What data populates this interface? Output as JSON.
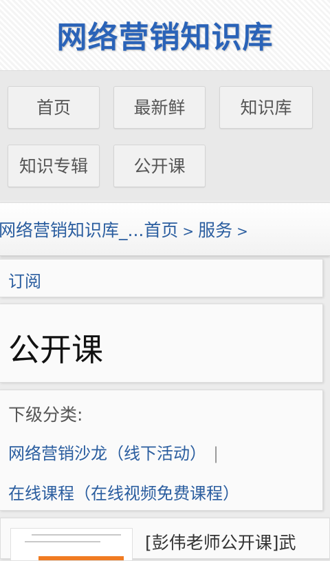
{
  "header": {
    "site_title": "网络营销知识库"
  },
  "nav": {
    "items": [
      {
        "label": "首页"
      },
      {
        "label": "最新鲜"
      },
      {
        "label": "知识库"
      },
      {
        "label": "知识专辑"
      },
      {
        "label": "公开课"
      }
    ]
  },
  "breadcrumb": {
    "items": [
      {
        "label": "网络营销知识库_..."
      },
      {
        "label": "首页"
      },
      {
        "label": "服务"
      }
    ],
    "separator": ">"
  },
  "subscribe": {
    "label": "订阅"
  },
  "page": {
    "heading": "公开课"
  },
  "subcategories": {
    "label": "下级分类:",
    "items": [
      {
        "label": "网络营销沙龙（线下活动）"
      },
      {
        "label": "在线课程（在线视频免费课程）"
      }
    ],
    "divider": "|"
  },
  "articles": [
    {
      "title": "[彭伟老师公开课]武"
    }
  ],
  "colors": {
    "brand": "#2a63b8",
    "link": "#2a5d9f",
    "thumb_accent": "#f07b22"
  }
}
